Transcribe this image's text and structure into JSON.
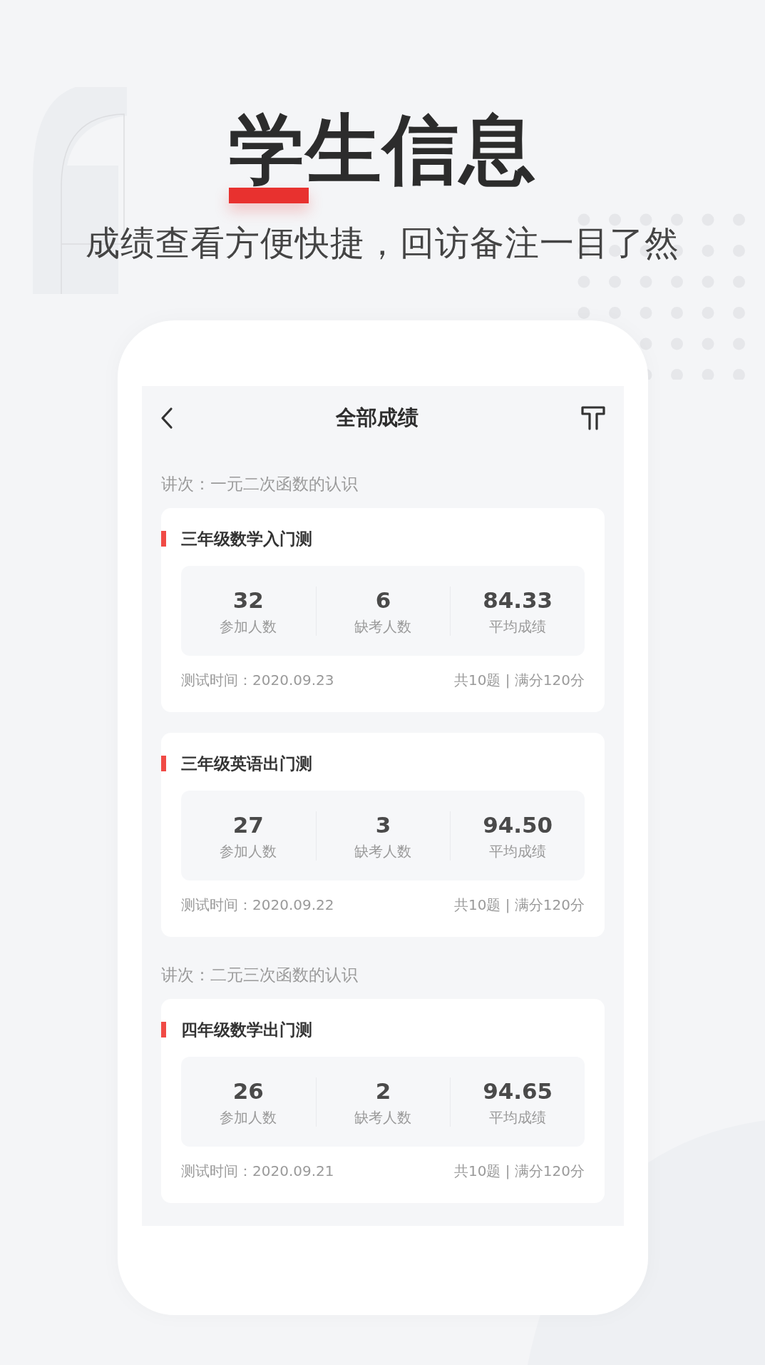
{
  "headline": {
    "title": "学生信息",
    "subtitle": "成绩查看方便快捷，回访备注一目了然"
  },
  "screen": {
    "title": "全部成绩",
    "sections": [
      {
        "label": "讲次：一元二次函数的认识",
        "cards": [
          {
            "title": "三年级数学入门测",
            "stats": [
              {
                "value": "32",
                "label": "参加人数"
              },
              {
                "value": "6",
                "label": "缺考人数"
              },
              {
                "value": "84.33",
                "label": "平均成绩"
              }
            ],
            "test_time": "测试时间：2020.09.23",
            "summary": "共10题 | 满分120分"
          },
          {
            "title": "三年级英语出门测",
            "stats": [
              {
                "value": "27",
                "label": "参加人数"
              },
              {
                "value": "3",
                "label": "缺考人数"
              },
              {
                "value": "94.50",
                "label": "平均成绩"
              }
            ],
            "test_time": "测试时间：2020.09.22",
            "summary": "共10题 | 满分120分"
          }
        ]
      },
      {
        "label": "讲次：二元三次函数的认识",
        "cards": [
          {
            "title": "四年级数学出门测",
            "stats": [
              {
                "value": "26",
                "label": "参加人数"
              },
              {
                "value": "2",
                "label": "缺考人数"
              },
              {
                "value": "94.65",
                "label": "平均成绩"
              }
            ],
            "test_time": "测试时间：2020.09.21",
            "summary": "共10题 | 满分120分"
          }
        ]
      }
    ]
  }
}
